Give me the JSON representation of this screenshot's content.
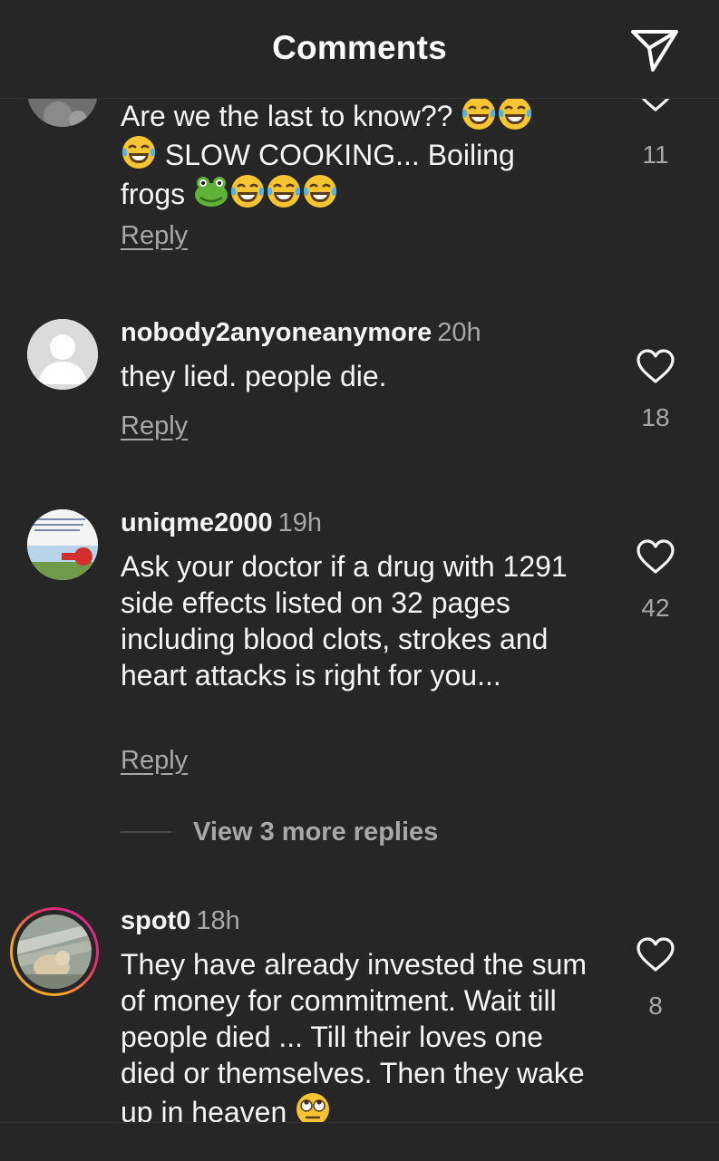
{
  "header": {
    "title": "Comments"
  },
  "icons": {
    "share": "paper-plane-icon",
    "like": "heart-icon",
    "laugh": "tears-of-joy-emoji",
    "frog": "frog-emoji",
    "eyeroll": "eye-roll-emoji"
  },
  "colors": {
    "background": "#262626",
    "text": "#f5f5f5",
    "secondary": "#a8a8a8",
    "story_ring_start": "#f9a825",
    "story_ring_end": "#d6249f"
  },
  "comments": [
    {
      "username": "",
      "time": "",
      "text_line1": "Are we the last to know??",
      "text_line2": "SLOW COOKING... Boiling",
      "text_line3": "frogs",
      "reply_label": "Reply",
      "likes": "11"
    },
    {
      "username": "nobody2anyoneanymore",
      "time": "20h",
      "text": "they lied. people die.",
      "reply_label": "Reply",
      "likes": "18"
    },
    {
      "username": "uniqme2000",
      "time": "19h",
      "text": "Ask your doctor if a drug with 1291 side effects listed on 32 pages including blood clots, strokes and heart attacks is right for you...",
      "reply_label": "Reply",
      "likes": "42",
      "more_replies": "View 3 more replies"
    },
    {
      "username": "spot0",
      "time": "18h",
      "text": "They have already invested the sum of money for commitment. Wait till people died ... Till their loves one died or themselves. Then they wake up in heaven",
      "likes": "8"
    }
  ]
}
